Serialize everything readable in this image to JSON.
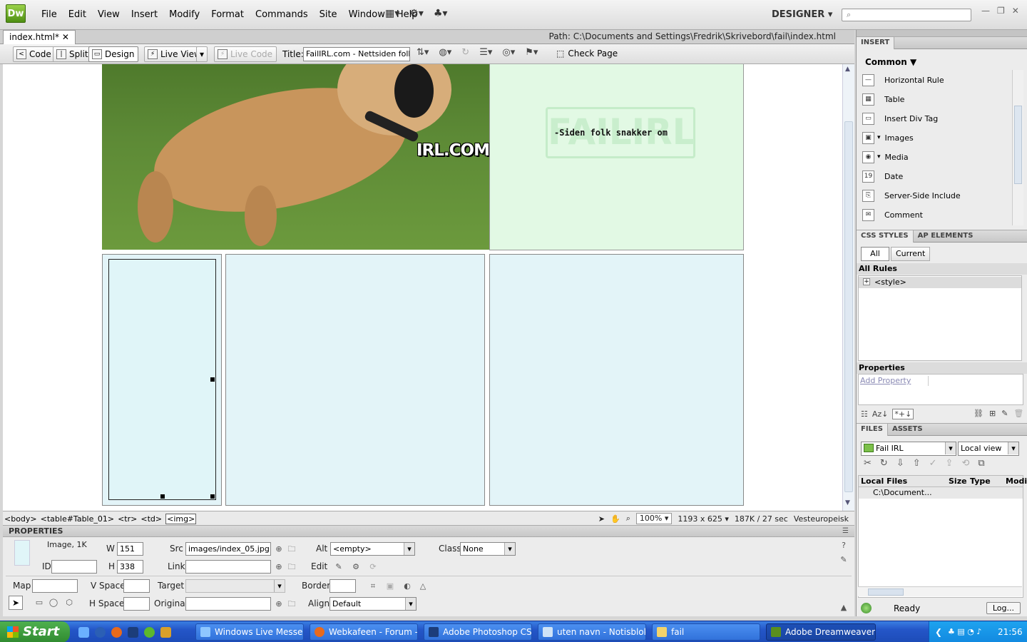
{
  "app": {
    "logo": "Dw",
    "workspace": "DESIGNER"
  },
  "menu": [
    "File",
    "Edit",
    "View",
    "Insert",
    "Modify",
    "Format",
    "Commands",
    "Site",
    "Window",
    "Help"
  ],
  "document": {
    "tab_label": "index.html*",
    "path": "Path:  C:\\Documents and Settings\\Fredrik\\Skrivebord\\fail\\index.html"
  },
  "doc_toolbar": {
    "code": "Code",
    "split": "Split",
    "design": "Design",
    "live_view": "Live View",
    "live_code": "Live Code",
    "title_label": "Title:",
    "title_value": "FailIRL.com - Nettsiden folk sr",
    "check_page": "Check Page"
  },
  "canvas": {
    "banner_text": "IRL.COM",
    "watermark": "FAILIRL",
    "slogan": "-Siden folk snakker om"
  },
  "status": {
    "tags": [
      "<body>",
      "<table#Table_01>",
      "<tr>",
      "<td>"
    ],
    "selected_tag": "<img>",
    "zoom": "100%",
    "size": "1193 x 625",
    "download": "187K / 27 sec",
    "encoding": "Vesteuropeisk"
  },
  "properties": {
    "header": "PROPERTIES",
    "image_info": "Image, 1K",
    "labels": {
      "w": "W",
      "h": "H",
      "id": "ID",
      "src": "Src",
      "link": "Link",
      "alt": "Alt",
      "edit": "Edit",
      "class": "Class",
      "map": "Map",
      "vspace": "V Space",
      "hspace": "H Space",
      "target": "Target",
      "original": "Original",
      "border": "Border",
      "align": "Align"
    },
    "w": "151",
    "h": "338",
    "src": "images/index_05.jpg",
    "alt": "<empty>",
    "class": "None",
    "align": "Default"
  },
  "insert_panel": {
    "tab": "INSERT",
    "category": "Common",
    "items": [
      "Horizontal Rule",
      "Table",
      "Insert Div Tag",
      "Images",
      "Media",
      "Date",
      "Server-Side Include",
      "Comment"
    ]
  },
  "css_panel": {
    "tabs": [
      "CSS STYLES",
      "AP ELEMENTS"
    ],
    "modes": [
      "All",
      "Current"
    ],
    "all_rules": "All Rules",
    "rule": "<style>",
    "properties": "Properties",
    "add_property": "Add Property"
  },
  "files_panel": {
    "tabs": [
      "FILES",
      "ASSETS"
    ],
    "site": "Fail IRL",
    "view": "Local view",
    "columns": [
      "Local Files",
      "Size",
      "Type",
      "Modi"
    ],
    "rows": [
      "C:\\Document..."
    ],
    "status": "Ready",
    "log_button": "Log..."
  },
  "taskbar": {
    "start": "Start",
    "tasks": [
      "Windows Live Messen...",
      "Webkafeen - Forum -...",
      "Adobe Photoshop CS...",
      "uten navn - Notisblokk",
      "fail",
      "Adobe Dreamweaver ..."
    ],
    "clock": "21:56"
  }
}
